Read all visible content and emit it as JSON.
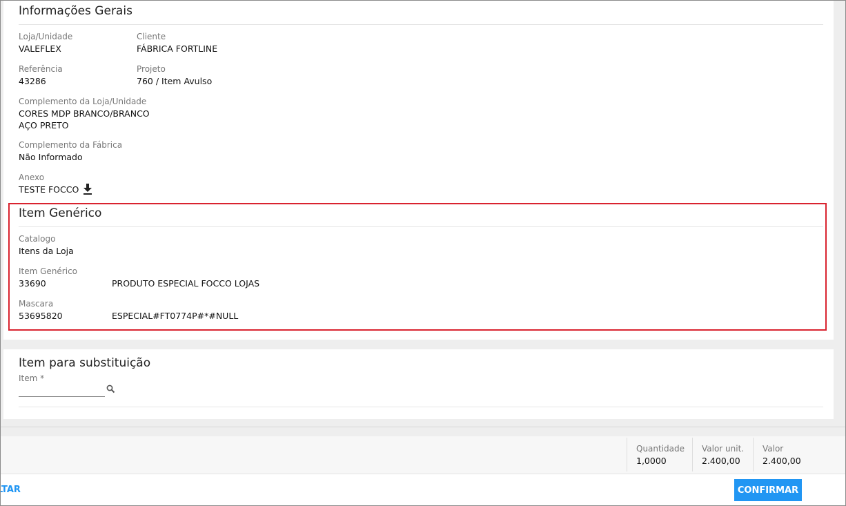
{
  "general": {
    "title": "Informações Gerais",
    "loja_label": "Loja/Unidade",
    "loja_value": "VALEFLEX",
    "cliente_label": "Cliente",
    "cliente_value": "FÁBRICA FORTLINE",
    "referencia_label": "Referência",
    "referencia_value": "43286",
    "projeto_label": "Projeto",
    "projeto_value": "760 / Item Avulso",
    "complemento_loja_label": "Complemento da Loja/Unidade",
    "complemento_loja_line1": "CORES MDP BRANCO/BRANCO",
    "complemento_loja_line2": "AÇO PRETO",
    "complemento_fabrica_label": "Complemento da Fábrica",
    "complemento_fabrica_value": "Não Informado",
    "anexo_label": "Anexo",
    "anexo_value": "TESTE FOCCO",
    "anexo_icon": "download-icon"
  },
  "generic_item": {
    "title": "Item Genérico",
    "catalogo_label": "Catalogo",
    "catalogo_value": "Itens da Loja",
    "item_label": "Item Genérico",
    "item_code": "33690",
    "item_desc": "PRODUTO ESPECIAL FOCCO LOJAS",
    "mascara_label": "Mascara",
    "mascara_code": "53695820",
    "mascara_desc": "ESPECIAL#FT0774P#*#NULL",
    "highlight_color": "#d9232f"
  },
  "substitution": {
    "title": "Item para substituição",
    "item_label": "Item *",
    "item_value": "",
    "search_icon": "search-icon"
  },
  "totals": {
    "quantidade_label": "Quantidade",
    "quantidade_value": "1,0000",
    "valor_unit_label": "Valor unit.",
    "valor_unit_value": "2.400,00",
    "valor_label": "Valor",
    "valor_value": "2.400,00"
  },
  "actions": {
    "back_label": "VOLTAR",
    "confirm_label": "CONFIRMAR",
    "accent_color": "#2196f3"
  }
}
